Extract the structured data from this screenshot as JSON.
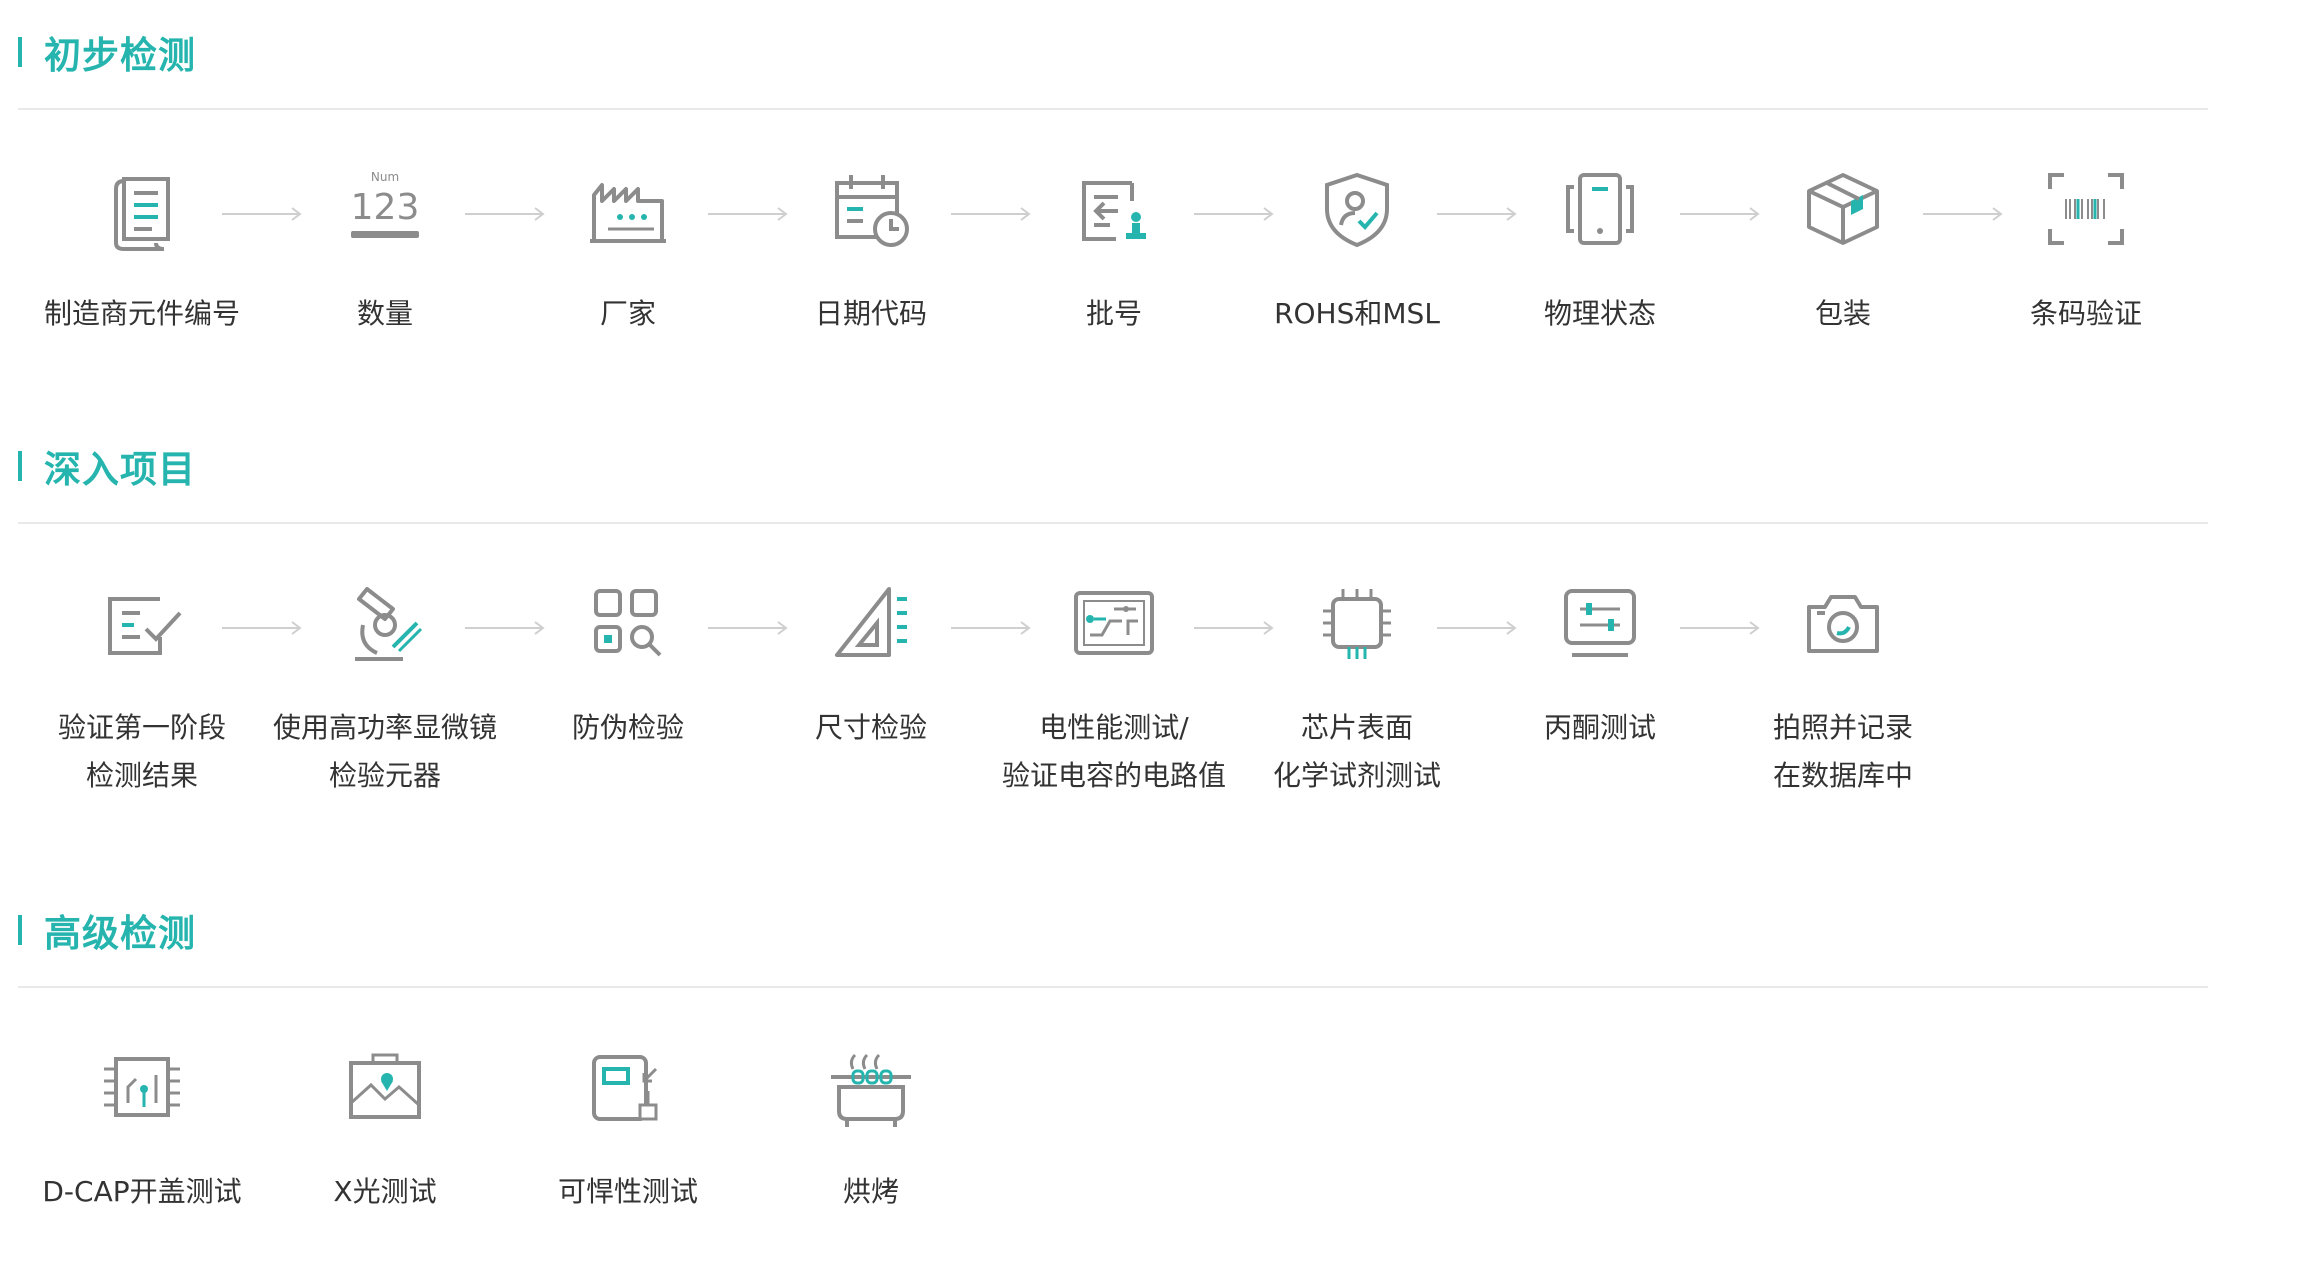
{
  "colors": {
    "accent": "#26b5ae",
    "icon_gray": "#8c8c8c",
    "text": "#333333",
    "divider": "#e9e9e9"
  },
  "sections": [
    {
      "title": "初步检测",
      "items": [
        {
          "icon": "document-list-icon",
          "label": [
            "制造商元件编号"
          ]
        },
        {
          "icon": "number-123-icon",
          "icon_text": [
            "Num",
            "123"
          ],
          "label": [
            "数量"
          ]
        },
        {
          "icon": "factory-icon",
          "label": [
            "厂家"
          ]
        },
        {
          "icon": "calendar-clock-icon",
          "label": [
            "日期代码"
          ]
        },
        {
          "icon": "batch-stamp-icon",
          "label": [
            "批号"
          ]
        },
        {
          "icon": "shield-user-check-icon",
          "label": [
            "ROHS和MSL"
          ]
        },
        {
          "icon": "phone-device-icon",
          "label": [
            "物理状态"
          ]
        },
        {
          "icon": "package-box-icon",
          "label": [
            "包装"
          ]
        },
        {
          "icon": "barcode-scan-icon",
          "label": [
            "条码验证"
          ]
        }
      ]
    },
    {
      "title": "深入项目",
      "items": [
        {
          "icon": "form-check-icon",
          "label": [
            "验证第一阶段",
            "检测结果"
          ]
        },
        {
          "icon": "microscope-icon",
          "label": [
            "使用高功率显微镜",
            "检验元器"
          ]
        },
        {
          "icon": "qr-search-icon",
          "label": [
            "防伪检验"
          ]
        },
        {
          "icon": "set-square-ruler-icon",
          "label": [
            "尺寸检验"
          ]
        },
        {
          "icon": "circuit-board-icon",
          "label": [
            "电性能测试/",
            "验证电容的电路值"
          ]
        },
        {
          "icon": "chip-icon",
          "label": [
            "芯片表面",
            "化学试剂测试"
          ]
        },
        {
          "icon": "monitor-sliders-icon",
          "label": [
            "丙酮测试"
          ]
        },
        {
          "icon": "camera-icon",
          "label": [
            "拍照并记录",
            "在数据库中"
          ]
        }
      ]
    },
    {
      "title": "高级检测",
      "items": [
        {
          "icon": "decap-chip-icon",
          "label": [
            "D-CAP开盖测试"
          ]
        },
        {
          "icon": "xray-image-icon",
          "label": [
            "X光测试"
          ]
        },
        {
          "icon": "solder-device-icon",
          "label": [
            "可悍性测试"
          ]
        },
        {
          "icon": "baking-oven-icon",
          "label": [
            "烘烤"
          ]
        }
      ]
    }
  ]
}
